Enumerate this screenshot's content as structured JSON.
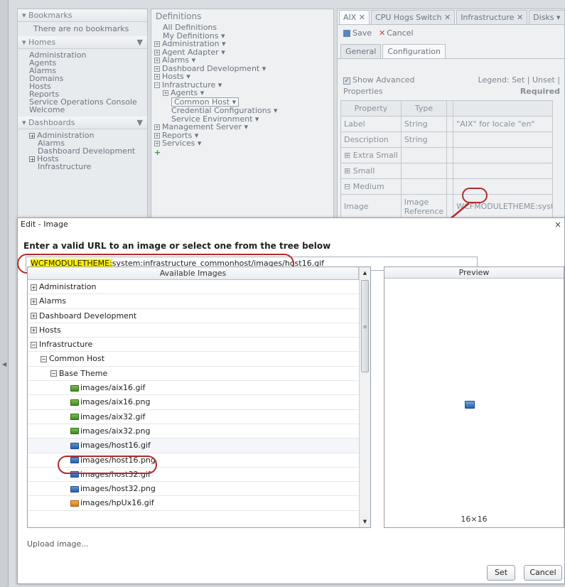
{
  "bookmarks": {
    "header": "Bookmarks",
    "empty_text": "There are no bookmarks"
  },
  "homes": {
    "header": "Homes",
    "items": [
      "Administration",
      "Agents",
      "Alarms",
      "Domains",
      "Hosts",
      "Reports",
      "Service Operations Console",
      "Welcome"
    ]
  },
  "dashboards": {
    "header": "Dashboards",
    "items": [
      "Administration",
      "Alarms",
      "Dashboard Development",
      "Hosts",
      "Infrastructure"
    ]
  },
  "definitions": {
    "title": "Definitions",
    "items": [
      {
        "label": "All Definitions",
        "indent": 1,
        "expander": ""
      },
      {
        "label": "My Definitions ▾",
        "indent": 1,
        "expander": ""
      },
      {
        "label": "Administration ▾",
        "indent": 0,
        "expander": "+"
      },
      {
        "label": "Agent Adapter ▾",
        "indent": 0,
        "expander": "+"
      },
      {
        "label": "Alarms ▾",
        "indent": 0,
        "expander": "+"
      },
      {
        "label": "Dashboard Development ▾",
        "indent": 0,
        "expander": "+"
      },
      {
        "label": "Hosts ▾",
        "indent": 0,
        "expander": "+"
      },
      {
        "label": "Infrastructure ▾",
        "indent": 0,
        "expander": "−"
      },
      {
        "label": "Agents ▾",
        "indent": 2,
        "expander": "+"
      },
      {
        "label": "Common Host ▾",
        "indent": 3,
        "expander": "",
        "selected": true
      },
      {
        "label": "Credential Configurations ▾",
        "indent": 3,
        "expander": ""
      },
      {
        "label": "Service Environment ▾",
        "indent": 3,
        "expander": ""
      },
      {
        "label": "Management Server ▾",
        "indent": 0,
        "expander": "+"
      },
      {
        "label": "Reports ▾",
        "indent": 0,
        "expander": "+"
      },
      {
        "label": "Services ▾",
        "indent": 0,
        "expander": "+"
      }
    ],
    "add_glyph": "+"
  },
  "editor": {
    "tabs": [
      "AIX ✕",
      "CPU Hogs Switch ✕",
      "Infrastructure ✕",
      "Disks ▾"
    ],
    "save_label": "Save",
    "cancel_label": "Cancel",
    "subtabs": [
      "General",
      "Configuration"
    ],
    "show_advanced": "Show Advanced Properties",
    "legend": "Legend: Set | Unset |",
    "legend_required": "Required",
    "table_headers": [
      "Property",
      "Type",
      "",
      ""
    ],
    "table_rows": [
      [
        "Label",
        "String",
        "",
        "\"AIX\" for locale \"en\""
      ],
      [
        "Description",
        "String",
        "",
        ""
      ],
      [
        "⊞ Extra Small",
        "",
        "",
        ""
      ],
      [
        "⊞ Small",
        "",
        "",
        ""
      ],
      [
        "⊟ Medium",
        "",
        "",
        ""
      ],
      [
        "Image",
        "Image Reference",
        "",
        "WCFMODULETHEME:syste"
      ]
    ]
  },
  "dialog": {
    "title": "Edit - Image",
    "close": "×",
    "instruction": "Enter a valid URL to an image or select one from the tree below",
    "url_highlight": "WCFMODULETHEME:",
    "url_rest": "system:infrastructure_commonhost/images/host16.gif",
    "tree_header": "Available Images",
    "tree_rows": [
      {
        "label": "Administration",
        "level": 0,
        "expander": "+",
        "icon": ""
      },
      {
        "label": "Alarms",
        "level": 0,
        "expander": "+",
        "icon": ""
      },
      {
        "label": "Dashboard Development",
        "level": 0,
        "expander": "+",
        "icon": ""
      },
      {
        "label": "Hosts",
        "level": 0,
        "expander": "+",
        "icon": ""
      },
      {
        "label": "Infrastructure",
        "level": 0,
        "expander": "−",
        "icon": ""
      },
      {
        "label": "Common Host",
        "level": 1,
        "expander": "−",
        "icon": ""
      },
      {
        "label": "Base Theme",
        "level": 2,
        "expander": "−",
        "icon": ""
      },
      {
        "label": "images/aix16.gif",
        "level": 3,
        "expander": "",
        "icon": "green"
      },
      {
        "label": "images/aix16.png",
        "level": 3,
        "expander": "",
        "icon": "green"
      },
      {
        "label": "images/aix32.gif",
        "level": 3,
        "expander": "",
        "icon": "green"
      },
      {
        "label": "images/aix32.png",
        "level": 3,
        "expander": "",
        "icon": "green"
      },
      {
        "label": "images/host16.gif",
        "level": 3,
        "expander": "",
        "icon": "blue",
        "selected": true
      },
      {
        "label": "images/host16.png",
        "level": 3,
        "expander": "",
        "icon": "blue"
      },
      {
        "label": "images/host32.gif",
        "level": 3,
        "expander": "",
        "icon": "blue"
      },
      {
        "label": "images/host32.png",
        "level": 3,
        "expander": "",
        "icon": "blue"
      },
      {
        "label": "images/hpUx16.gif",
        "level": 3,
        "expander": "",
        "icon": "orange"
      }
    ],
    "preview_header": "Preview",
    "preview_dimensions": "16×16",
    "upload_link": "Upload image...",
    "set_label": "Set",
    "cancel_label": "Cancel"
  },
  "colors": {
    "annotation": "#b32a2a",
    "highlight": "#fff200"
  }
}
